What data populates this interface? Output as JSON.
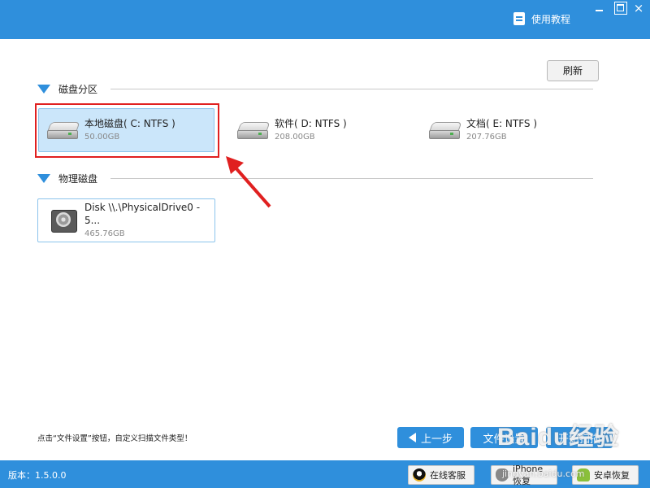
{
  "titlebar": {
    "help_label": "使用教程",
    "help_icon": "book-icon",
    "close_glyph": "×"
  },
  "toolbar": {
    "refresh_label": "刷新"
  },
  "partitions": {
    "title": "磁盘分区",
    "drives": [
      {
        "name": "本地磁盘( C: NTFS )",
        "size": "50.00GB",
        "selected": true
      },
      {
        "name": "软件( D: NTFS )",
        "size": "208.00GB",
        "selected": false
      },
      {
        "name": "文档( E: NTFS )",
        "size": "207.76GB",
        "selected": false
      }
    ]
  },
  "physical": {
    "title": "物理磁盘",
    "drives": [
      {
        "name": "Disk \\\\.\\PhysicalDrive0 - 5...",
        "size": "465.76GB"
      }
    ]
  },
  "footer": {
    "hint": "点击“文件设置”按钮，自定义扫描文件类型！",
    "back_label": "上一步",
    "settings_label": "文件设置",
    "scan_label": "开始扫描"
  },
  "statusbar": {
    "version": "版本：1.5.0.0",
    "online_service": "在线客服",
    "iphone_restore": "iPhone恢复",
    "android_restore": "安卓恢复"
  },
  "watermark": {
    "text": "Baidu经验",
    "url": "jingyan.baidu.com"
  },
  "colors": {
    "accent": "#2f8fdc",
    "highlight": "#e02020",
    "selected_bg": "#cbe6fa"
  }
}
